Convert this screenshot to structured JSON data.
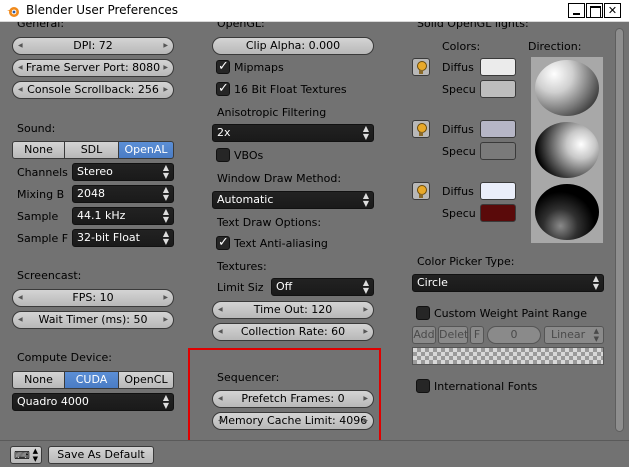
{
  "window": {
    "title": "Blender User Preferences"
  },
  "general": {
    "heading": "General:",
    "dpi": "DPI: 72",
    "frame_server_port": "Frame Server Port: 8080",
    "console_scrollback": "Console Scrollback: 256"
  },
  "sound": {
    "heading": "Sound:",
    "options": [
      "None",
      "SDL",
      "OpenAL"
    ],
    "selected": "OpenAL",
    "channels_label": "Channels",
    "channels_value": "Stereo",
    "mixing_label": "Mixing B",
    "mixing_value": "2048",
    "sample_label": "Sample",
    "sample_value": "44.1 kHz",
    "sample_format_label": "Sample F",
    "sample_format_value": "32-bit Float"
  },
  "screencast": {
    "heading": "Screencast:",
    "fps": "FPS: 10",
    "wait_timer": "Wait Timer (ms): 50"
  },
  "compute": {
    "heading": "Compute Device:",
    "options": [
      "None",
      "CUDA",
      "OpenCL"
    ],
    "selected": "CUDA",
    "device": "Quadro 4000"
  },
  "opengl": {
    "heading": "OpenGL:",
    "clip_alpha": "Clip Alpha: 0.000",
    "mipmaps": "Mipmaps",
    "float_textures": "16 Bit Float Textures",
    "aniso_label": "Anisotropic Filtering",
    "aniso_value": "2x",
    "vbos": "VBOs",
    "draw_method_label": "Window Draw Method:",
    "draw_method_value": "Automatic",
    "text_draw_label": "Text Draw Options:",
    "anti_aliasing": "Text Anti-aliasing",
    "textures_label": "Textures:",
    "limit_size_label": "Limit Siz",
    "limit_size_value": "Off",
    "time_out": "Time Out: 120",
    "collection_rate": "Collection Rate: 60",
    "sequencer_label": "Sequencer:",
    "prefetch_frames": "Prefetch Frames: 0",
    "memory_cache_limit": "Memory Cache Limit: 4096"
  },
  "lights": {
    "heading": "Solid OpenGL lights:",
    "colors_label": "Colors:",
    "direction_label": "Direction:",
    "diffuse_label": "Diffus",
    "specular_label": "Specu",
    "light1": {
      "diffuse": "#ebebeb",
      "specular": "#bdbdbd"
    },
    "light2": {
      "diffuse": "#b6b6c6",
      "specular": "#7a7a7a"
    },
    "light3": {
      "diffuse": "#eaeefa",
      "specular": "#5a0a0a"
    }
  },
  "color_picker": {
    "label": "Color Picker Type:",
    "value": "Circle"
  },
  "weight_paint": {
    "label": "Custom Weight Paint Range",
    "add": "Add",
    "delete": "Delet",
    "f": "F",
    "value": "0",
    "interp": "Linear"
  },
  "international_fonts": "International Fonts",
  "footer": {
    "save_default": "Save As Default"
  }
}
